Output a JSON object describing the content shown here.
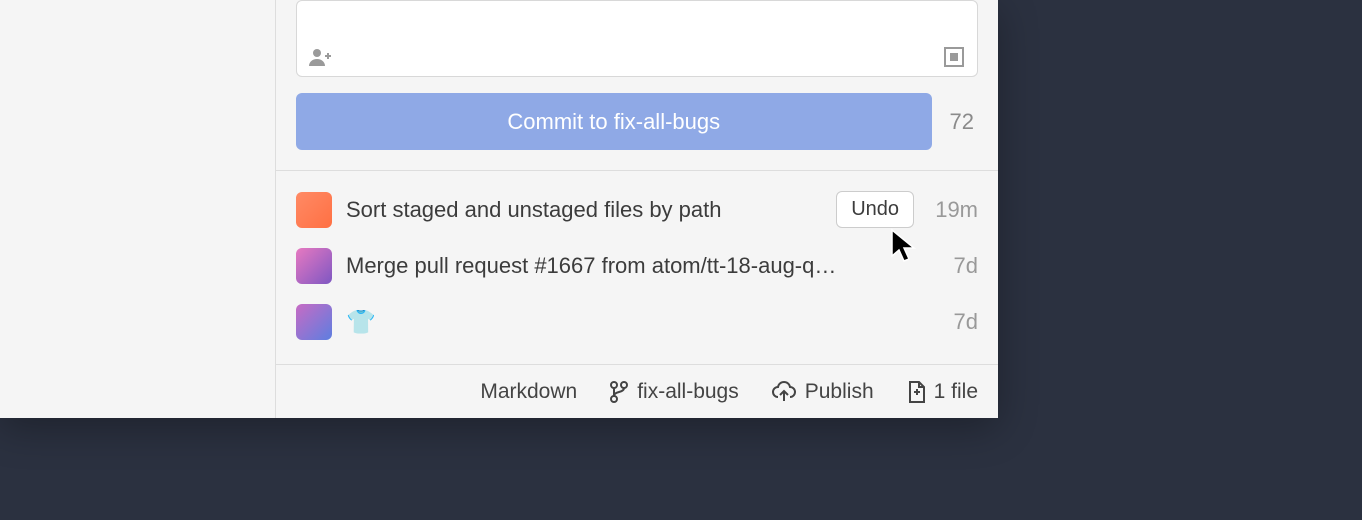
{
  "commit": {
    "button_label": "Commit to fix-all-bugs",
    "counter": "72"
  },
  "commits": [
    {
      "message": "Sort staged and unstaged files by path",
      "undo_label": "Undo",
      "time": "19m"
    },
    {
      "message": "Merge pull request #1667 from atom/tt-18-aug-q…",
      "time": "7d"
    },
    {
      "message": "",
      "emoji": "👕",
      "time": "7d"
    }
  ],
  "status_bar": {
    "markdown": "Markdown",
    "branch": "fix-all-bugs",
    "publish": "Publish",
    "files": "1 file"
  }
}
